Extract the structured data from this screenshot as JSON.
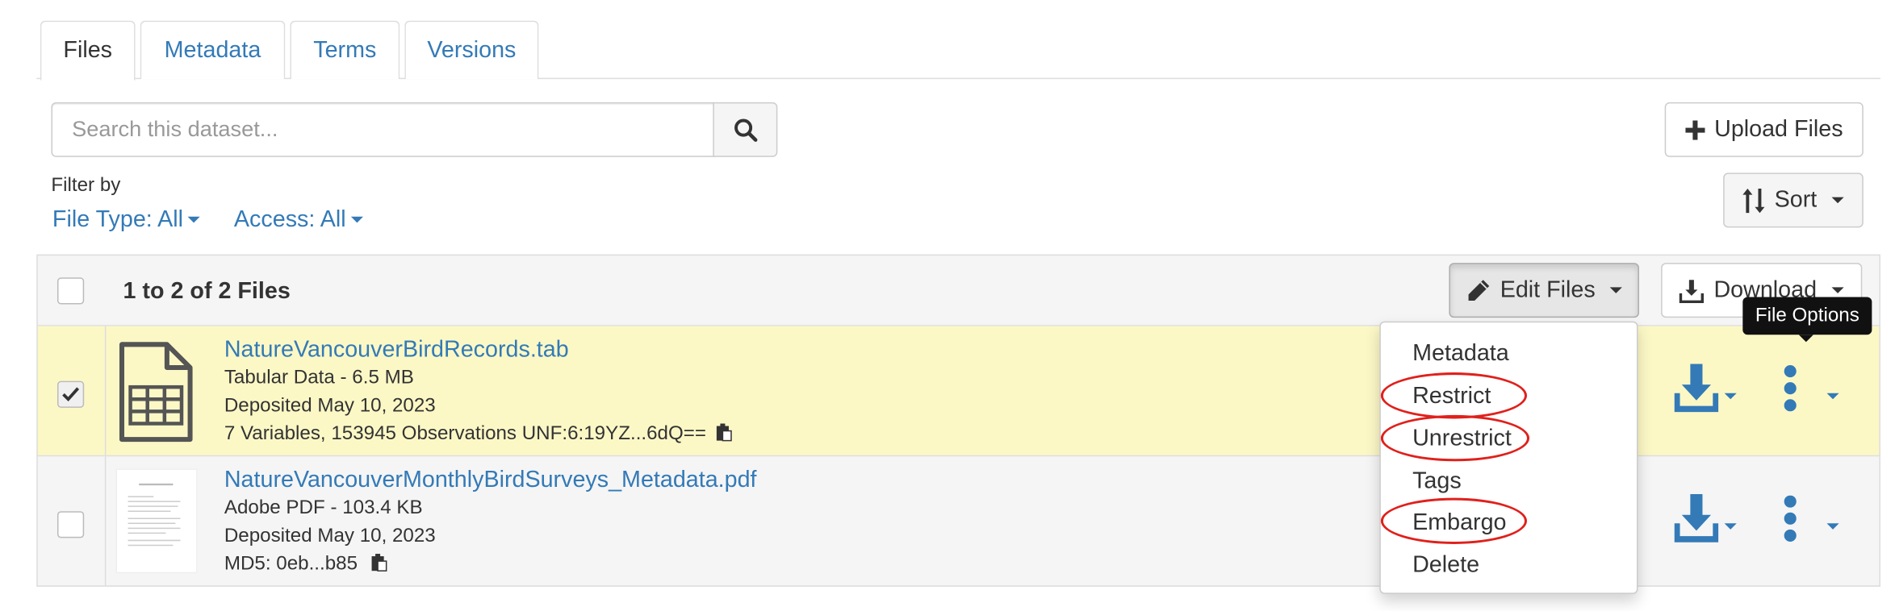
{
  "tabs": [
    {
      "label": "Files",
      "active": true
    },
    {
      "label": "Metadata",
      "active": false
    },
    {
      "label": "Terms",
      "active": false
    },
    {
      "label": "Versions",
      "active": false
    }
  ],
  "search": {
    "placeholder": "Search this dataset...",
    "value": "",
    "icon": "search-icon"
  },
  "toolbar": {
    "upload_label": "Upload Files",
    "sort_label": "Sort",
    "edit_files_label": "Edit Files",
    "download_label": "Download"
  },
  "filters": {
    "label": "Filter by",
    "file_type": "File Type: All",
    "access": "Access: All"
  },
  "table": {
    "count_label": "1 to 2 of 2 Files",
    "select_all_checked": false
  },
  "files": [
    {
      "name": "NatureVancouverBirdRecords.tab",
      "type_size": "Tabular Data - 6.5 MB",
      "deposited": "Deposited May 10, 2023",
      "details": "7 Variables, 153945 Observations UNF:6:19YZ...6dQ==",
      "checked": true,
      "icon": "tabular-file-icon"
    },
    {
      "name": "NatureVancouverMonthlyBirdSurveys_Metadata.pdf",
      "type_size": "Adobe PDF - 103.4 KB",
      "deposited": "Deposited May 10, 2023",
      "details": "MD5: 0eb...b85",
      "checked": false,
      "icon": "pdf-thumbnail"
    }
  ],
  "edit_menu": {
    "items": [
      "Metadata",
      "Restrict",
      "Unrestrict",
      "Tags",
      "Embargo",
      "Delete"
    ],
    "highlighted": [
      "Restrict",
      "Unrestrict",
      "Embargo"
    ]
  },
  "tooltip": {
    "text": "File Options"
  },
  "colors": {
    "link": "#337ab7",
    "selected_row": "#fcf8c6",
    "highlight_circle": "#e0201b",
    "tooltip_bg": "#111111"
  }
}
